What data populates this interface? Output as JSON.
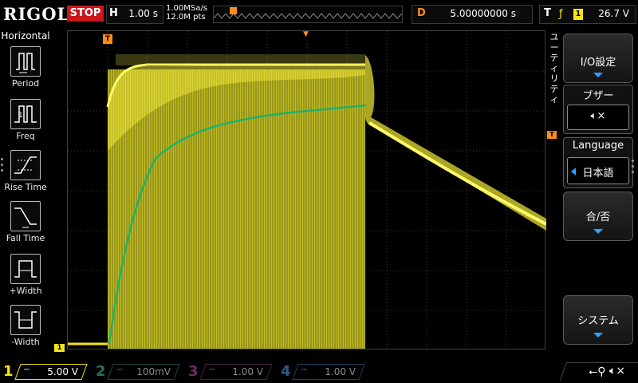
{
  "brand": {
    "logo": "RIGOL"
  },
  "header": {
    "run_status": "STOP",
    "timebase_label": "H",
    "timebase_value": "1.00 s",
    "sample_rate": "1.00MSa/s",
    "memory_depth": "12.0M pts",
    "delay_label": "D",
    "delay_value": "5.00000000 s",
    "trigger_label": "T",
    "trigger_source": "1",
    "trigger_level": "26.7 V"
  },
  "left_panel": {
    "title": "Horizontal",
    "items": [
      {
        "label": "Period",
        "icon": "period-icon"
      },
      {
        "label": "Freq",
        "icon": "freq-icon"
      },
      {
        "label": "Rise Time",
        "icon": "rise-time-icon"
      },
      {
        "label": "Fall Time",
        "icon": "fall-time-icon"
      },
      {
        "label": "+Width",
        "icon": "pos-width-icon"
      },
      {
        "label": "-Width",
        "icon": "neg-width-icon"
      }
    ]
  },
  "screen": {
    "ch1_marker": "1",
    "trigger_marker": "T",
    "trigger_level_marker": "T",
    "colors": {
      "ch1": "#f5e416",
      "math": "#1db36b",
      "trigger": "#ff8c1a",
      "grid": "#3c3c3c"
    }
  },
  "side_tab": "ユーティリティ",
  "right_menu": {
    "io_settings": "I/O設定",
    "buzzer_label": "ブザー",
    "buzzer_icon": "speaker-mute-icon",
    "language_label": "Language",
    "language_value": "日本語",
    "pass_fail": "合/否",
    "system": "システム"
  },
  "channels": [
    {
      "number": "1",
      "value": "5.00 V",
      "color": "#f5e416",
      "active": true
    },
    {
      "number": "2",
      "value": "100mV",
      "color": "#2aa58c",
      "active": false
    },
    {
      "number": "3",
      "value": "1.00 V",
      "color": "#b02aa6",
      "active": false
    },
    {
      "number": "4",
      "value": "1.00 V",
      "color": "#2b7fd6",
      "active": false
    }
  ],
  "status_icons": [
    "usb-icon",
    "speaker-mute-icon"
  ]
}
